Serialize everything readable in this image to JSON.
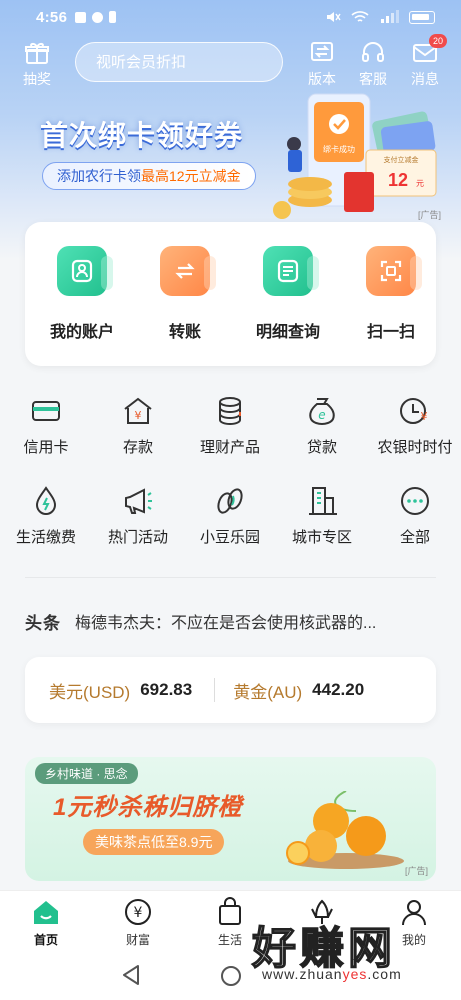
{
  "status_bar": {
    "time": "4:56",
    "network": "ᴬ",
    "battery_icon": "battery-icon"
  },
  "topnav": {
    "lottery_label": "抽奖",
    "search_placeholder": "视听会员折扣",
    "version_label": "版本",
    "service_label": "客服",
    "messages_label": "消息",
    "messages_badge": "20"
  },
  "banner": {
    "title": "首次绑卡领好券",
    "subtitle_prefix": "添加农行卡领",
    "subtitle_highlight": "最高12元立减金",
    "art_card_label": "绑卡成功",
    "art_coupon_label": "支付立减金",
    "art_coupon_amount": "12",
    "art_coupon_unit": "元",
    "ad_tag": "[广告]"
  },
  "quick_actions": [
    {
      "label": "我的账户",
      "icon": "account-icon",
      "color": "green"
    },
    {
      "label": "转账",
      "icon": "transfer-icon",
      "color": "orange"
    },
    {
      "label": "明细查询",
      "icon": "details-icon",
      "color": "green"
    },
    {
      "label": "扫一扫",
      "icon": "scan-icon",
      "color": "orange"
    }
  ],
  "grid": [
    {
      "label": "信用卡",
      "icon": "credit-card-icon"
    },
    {
      "label": "存款",
      "icon": "deposit-icon"
    },
    {
      "label": "理财产品",
      "icon": "wealth-products-icon"
    },
    {
      "label": "贷款",
      "icon": "loan-icon"
    },
    {
      "label": "农银时时付",
      "icon": "instant-pay-icon"
    },
    {
      "label": "生活缴费",
      "icon": "utility-payment-icon"
    },
    {
      "label": "热门活动",
      "icon": "hot-activity-icon"
    },
    {
      "label": "小豆乐园",
      "icon": "bean-park-icon"
    },
    {
      "label": "城市专区",
      "icon": "city-zone-icon"
    },
    {
      "label": "全部",
      "icon": "more-icon"
    }
  ],
  "news": {
    "tag": "头条",
    "text": "梅德韦杰夫：不应在是否会使用核武器的..."
  },
  "rates": {
    "usd_label": "美元(USD)",
    "usd_value": "692.83",
    "gold_label": "黄金(AU)",
    "gold_value": "442.20"
  },
  "ad_banner": {
    "brand": "乡村味道 · 思念",
    "title": "1元秒杀秭归脐橙",
    "subtitle": "美味茶点低至8.9元",
    "ad_tag": "[广告]"
  },
  "tabbar": [
    {
      "label": "首页",
      "icon": "home-icon",
      "active": true
    },
    {
      "label": "财富",
      "icon": "wealth-icon",
      "active": false
    },
    {
      "label": "生活",
      "icon": "life-bag-icon",
      "active": false
    },
    {
      "label": "乡村",
      "icon": "village-icon",
      "active": false
    },
    {
      "label": "我的",
      "icon": "profile-icon",
      "active": false
    }
  ],
  "watermark": {
    "text": "好赚网",
    "url_prefix": "www.zhuan",
    "url_highlight": "yes",
    "url_suffix": ".com"
  },
  "colors": {
    "brand_green": "#22c08e",
    "accent_orange": "#ff8747",
    "hero_blue": "#9dc2f3",
    "gold_text": "#b57a2e",
    "badge_red": "#f04b4b"
  }
}
